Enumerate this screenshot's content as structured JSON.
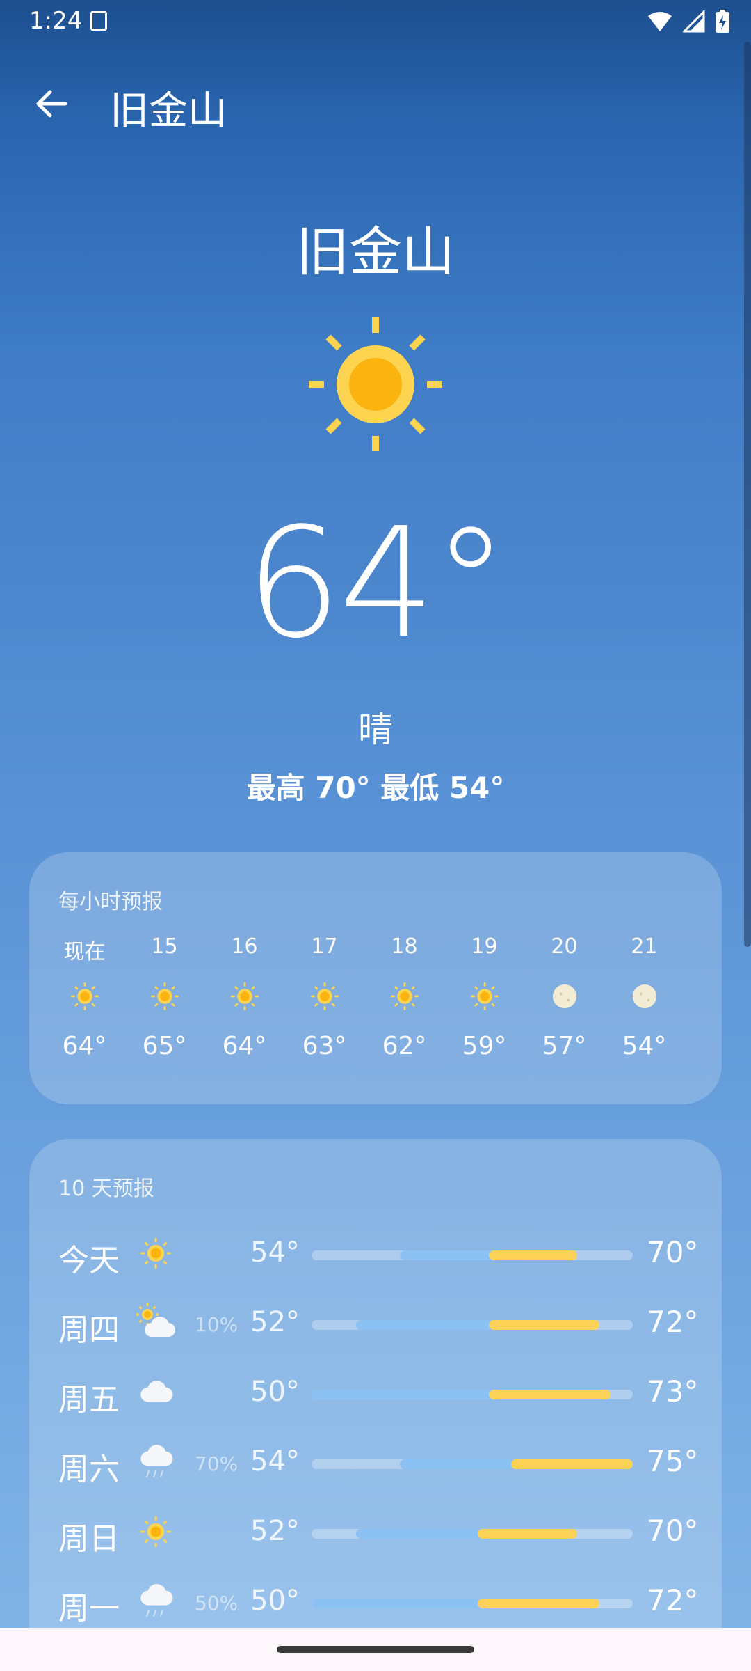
{
  "status_bar": {
    "time": "1:24",
    "icons": [
      "sim-card-icon",
      "wifi-icon",
      "signal-icon",
      "battery-charging-icon"
    ]
  },
  "app_bar": {
    "back_icon": "arrow-back-icon",
    "title": "旧金山"
  },
  "hero": {
    "city": "旧金山",
    "icon": "sun-icon",
    "temperature": "64°",
    "condition": "晴",
    "high_low": "最高 70° 最低 54°"
  },
  "hourly": {
    "title": "每小时预报",
    "items": [
      {
        "label": "现在",
        "icon": "sun",
        "temp": "64°"
      },
      {
        "label": "15",
        "icon": "sun",
        "temp": "65°"
      },
      {
        "label": "16",
        "icon": "sun",
        "temp": "64°"
      },
      {
        "label": "17",
        "icon": "sun",
        "temp": "63°"
      },
      {
        "label": "18",
        "icon": "sun",
        "temp": "62°"
      },
      {
        "label": "19",
        "icon": "sun",
        "temp": "59°"
      },
      {
        "label": "20",
        "icon": "moon",
        "temp": "57°"
      },
      {
        "label": "21",
        "icon": "moon",
        "temp": "54°"
      }
    ]
  },
  "daily": {
    "title": "10 天预报",
    "scale_min": 46,
    "scale_max": 75,
    "items": [
      {
        "day": "今天",
        "icon": "sun",
        "precip": "",
        "low": "54°",
        "high": "70°",
        "low_val": 54,
        "high_val": 70,
        "split_val": 62
      },
      {
        "day": "周四",
        "icon": "partly-cloudy",
        "precip": "10%",
        "low": "52°",
        "high": "72°",
        "low_val": 50,
        "high_val": 72,
        "split_val": 62
      },
      {
        "day": "周五",
        "icon": "cloud",
        "precip": "",
        "low": "50°",
        "high": "73°",
        "low_val": 46,
        "high_val": 73,
        "split_val": 62
      },
      {
        "day": "周六",
        "icon": "rain",
        "precip": "70%",
        "low": "54°",
        "high": "75°",
        "low_val": 54,
        "high_val": 75,
        "split_val": 64
      },
      {
        "day": "周日",
        "icon": "sun",
        "precip": "",
        "low": "52°",
        "high": "70°",
        "low_val": 50,
        "high_val": 70,
        "split_val": 61
      },
      {
        "day": "周一",
        "icon": "rain",
        "precip": "50%",
        "low": "50°",
        "high": "72°",
        "low_val": 46,
        "high_val": 72,
        "split_val": 61
      }
    ]
  },
  "colors": {
    "cool_bar": "#8cc2f3",
    "warm_bar": "#fcd256",
    "sun_outer": "#fdd44f",
    "sun_inner": "#fbb30f",
    "moon": "#f3ecd5"
  }
}
